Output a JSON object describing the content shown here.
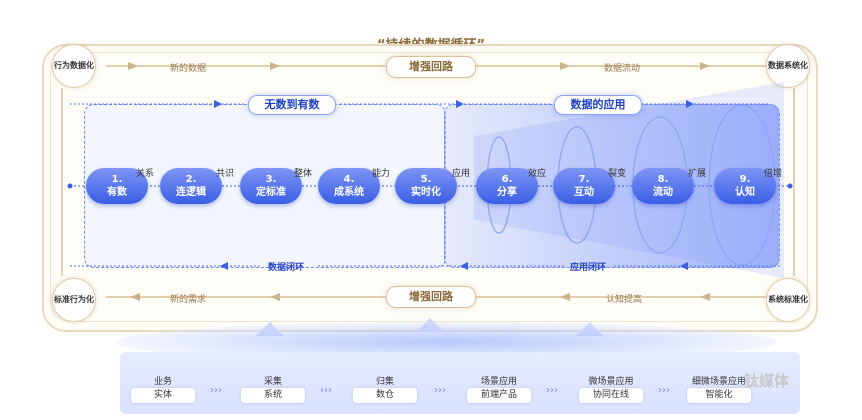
{
  "title": "“持续的数据循环”",
  "corners": {
    "top_left": "行为数据化",
    "top_right": "数据系统化",
    "bottom_left": "标准行为化",
    "bottom_right": "系统标准化"
  },
  "top_loop": {
    "label": "增强回路",
    "left_text": "新的数据",
    "right_text": "数据流动"
  },
  "bottom_loop": {
    "label": "增强回路",
    "left_text": "新的需求",
    "right_text": "认知提高"
  },
  "left_box": {
    "title": "无数到有数",
    "closure": "数据闭环"
  },
  "right_box": {
    "title": "数据的应用",
    "closure": "应用闭环"
  },
  "nodes": [
    {
      "num": "1.",
      "label": "有数"
    },
    {
      "num": "2.",
      "label": "连逻辑"
    },
    {
      "num": "3.",
      "label": "定标准"
    },
    {
      "num": "4.",
      "label": "成系统"
    },
    {
      "num": "5.",
      "label": "实时化"
    },
    {
      "num": "6.",
      "label": "分享"
    },
    {
      "num": "7.",
      "label": "互动"
    },
    {
      "num": "8.",
      "label": "流动"
    },
    {
      "num": "9.",
      "label": "认知"
    }
  ],
  "connectors": [
    "关系",
    "共识",
    "整体",
    "能力",
    "应用",
    "效应",
    "裂变",
    "扩展",
    "倍增"
  ],
  "bottom": [
    {
      "label": "业务",
      "box": "实体"
    },
    {
      "label": "采集",
      "box": "系统"
    },
    {
      "label": "归集",
      "box": "数仓"
    },
    {
      "label": "场景应用",
      "box": "前端产品"
    },
    {
      "label": "微场景应用",
      "box": "协同在线"
    },
    {
      "label": "细微场景应用",
      "box": "智能化"
    }
  ],
  "watermark": "钛媒体",
  "colors": {
    "node": "#3a5fe6",
    "gold": "#8a6a3a",
    "accent_blue": "#2a48c4"
  }
}
